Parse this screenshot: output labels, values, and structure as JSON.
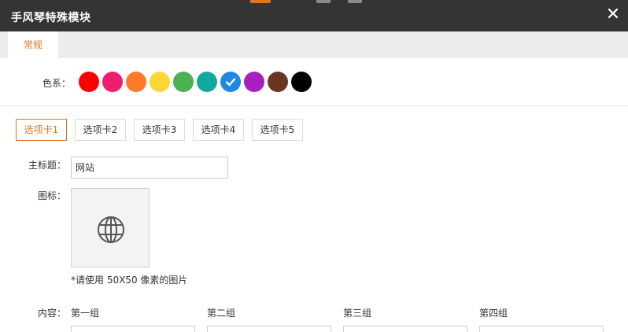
{
  "window": {
    "title": "手风琴特殊模块",
    "close_symbol": "✕"
  },
  "tabs": [
    {
      "label": "常规",
      "active": true
    }
  ],
  "colors": {
    "label": "色系：",
    "swatches": [
      "#ff0000",
      "#ef1d6f",
      "#fe7a2a",
      "#fdd736",
      "#4cb151",
      "#10a99b",
      "#1e88e5",
      "#a71fc0",
      "#6a3522",
      "#000000"
    ],
    "selected_index": 6,
    "accent": "#e0751f"
  },
  "subtabs": [
    "选项卡1",
    "选项卡2",
    "选项卡3",
    "选项卡4",
    "选项卡5"
  ],
  "subtab_active_index": 0,
  "form": {
    "main_title_label": "主标题：",
    "main_title_value": "网站",
    "icon_label": "图标：",
    "icon_name": "globe-icon",
    "icon_hint": "*请使用 50X50 像素的图片",
    "content_label": "内容：",
    "groups": [
      "第一组",
      "第二组",
      "第三组",
      "第四组"
    ]
  }
}
